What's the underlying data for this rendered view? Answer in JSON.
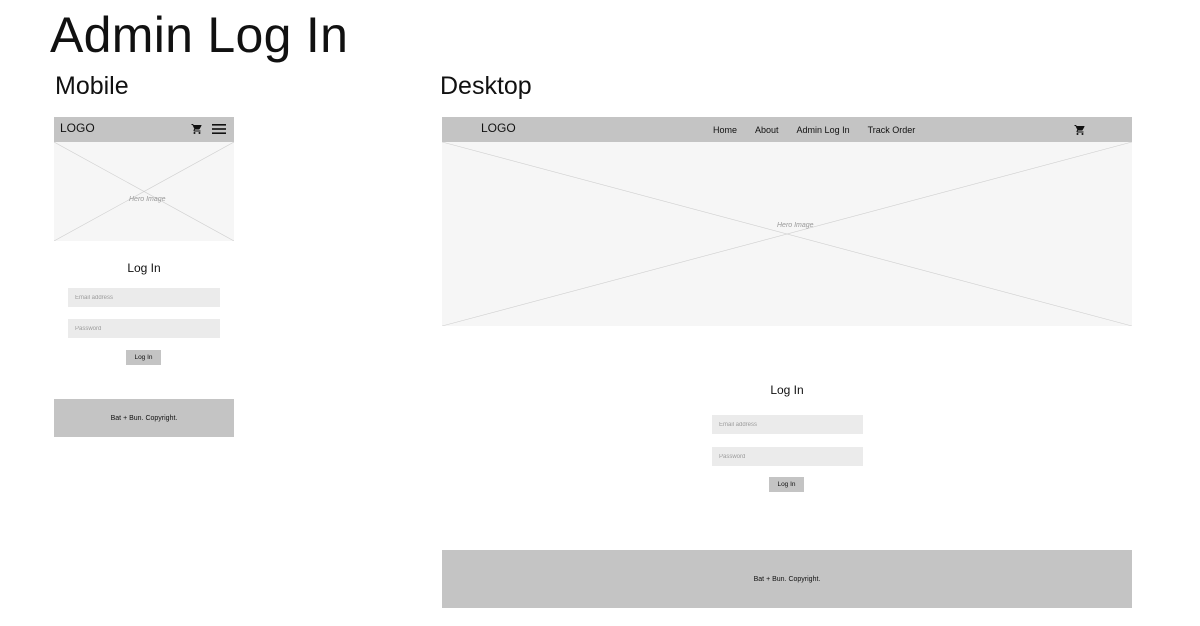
{
  "page": {
    "title": "Admin Log In"
  },
  "sections": {
    "mobile": "Mobile",
    "desktop": "Desktop"
  },
  "brand": {
    "logo": "LOGO"
  },
  "nav": {
    "links": [
      "Home",
      "About",
      "Admin Log In",
      "Track Order"
    ]
  },
  "hero": {
    "label": "Hero Image"
  },
  "form": {
    "title": "Log In",
    "email_placeholder": "Email address",
    "password_placeholder": "Password",
    "submit_label": "Log In"
  },
  "footer": {
    "text": "Bat + Bun. Copyright."
  },
  "icons": {
    "cart": "cart-icon",
    "menu": "hamburger-menu-icon"
  },
  "colors": {
    "bar": "#c4c4c4",
    "hero_bg": "#f6f6f6",
    "input_bg": "#ebebeb"
  }
}
